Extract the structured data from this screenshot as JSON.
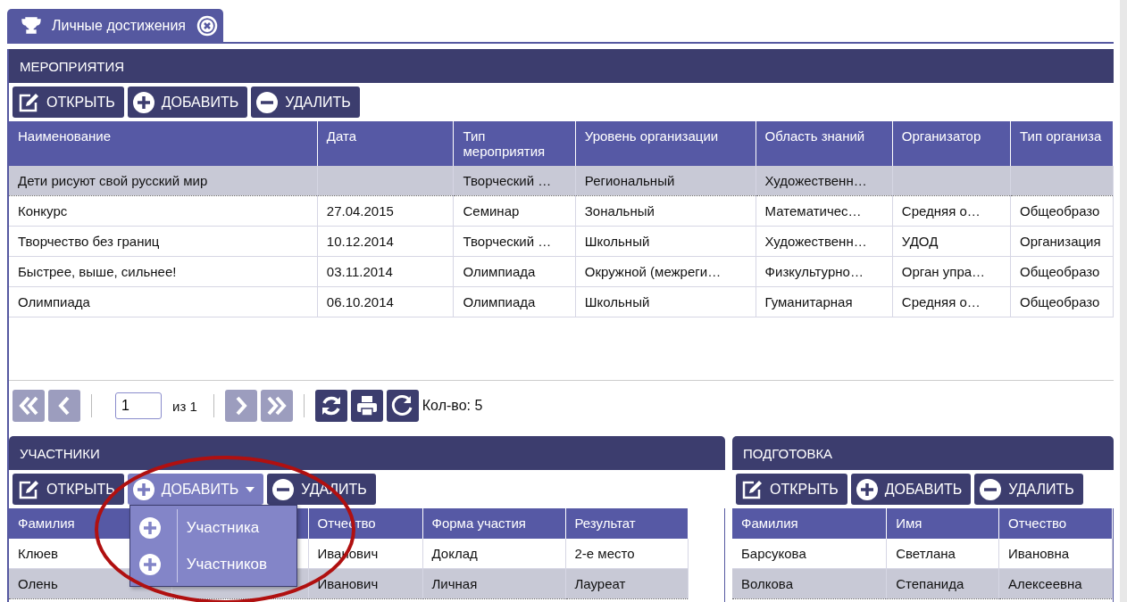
{
  "tab": {
    "label": "Личные достижения",
    "selected": true
  },
  "events": {
    "title": "МЕРОПРИЯТИЯ",
    "buttons": [
      {
        "kind": "open",
        "label": "ОТКРЫТЬ"
      },
      {
        "kind": "add",
        "label": "ДОБАВИТЬ"
      },
      {
        "kind": "delete",
        "label": "УДАЛИТЬ"
      }
    ],
    "columns": [
      "Наименование",
      "Дата",
      "Тип мероприятия",
      "Уровень организации",
      "Область знаний",
      "Организатор",
      "Тип организа"
    ],
    "rows": [
      {
        "selected": true,
        "cells": [
          "Дети рисуют свой русский мир",
          "",
          "Творческий …",
          "Региональный",
          "Художественн…",
          "",
          ""
        ]
      },
      {
        "selected": false,
        "cells": [
          "Конкурс",
          "27.04.2015",
          "Семинар",
          "Зональный",
          "Математичес…",
          "Средняя о…",
          "Общеобразо"
        ]
      },
      {
        "selected": false,
        "cells": [
          "Творчество без границ",
          "10.12.2014",
          "Творческий …",
          "Школьный",
          "Художественн…",
          "УДОД",
          "Организация"
        ]
      },
      {
        "selected": false,
        "cells": [
          "Быстрее, выше, сильнее!",
          "03.11.2014",
          "Олимпиада",
          "Окружной (межреги…",
          "Физкультурно…",
          "Орган упра…",
          "Общеобразо"
        ]
      },
      {
        "selected": false,
        "cells": [
          "Олимпиада",
          "06.10.2014",
          "Олимпиада",
          "Школьный",
          "Гуманитарная",
          "Средняя о…",
          "Общеобразо"
        ]
      }
    ],
    "pager": {
      "page": "1",
      "of": "из 1",
      "count": "Кол-во: 5",
      "first_disabled": true,
      "prev_disabled": true,
      "next_disabled": true,
      "last_disabled": true
    }
  },
  "participants": {
    "title": "УЧАСТНИКИ",
    "buttons": [
      {
        "kind": "open",
        "label": "ОТКРЫТЬ"
      },
      {
        "kind": "add",
        "label": "ДОБАВИТЬ",
        "expanded": true
      },
      {
        "kind": "delete",
        "label": "УДАЛИТЬ"
      }
    ],
    "menu": [
      "Участника",
      "Участников"
    ],
    "columns": [
      "Фамилия",
      "",
      "Отчество",
      "Форма участия",
      "Результат"
    ],
    "rows": [
      {
        "selected": false,
        "cells": [
          "Клюев",
          "",
          "Иванович",
          "Доклад",
          "2-е место"
        ]
      },
      {
        "selected": true,
        "cells": [
          "Олень",
          "",
          "Иванович",
          "Личная",
          "Лауреат"
        ]
      }
    ]
  },
  "preparation": {
    "title": "ПОДГОТОВКА",
    "buttons": [
      {
        "kind": "open",
        "label": "ОТКРЫТЬ"
      },
      {
        "kind": "add",
        "label": "ДОБАВИТЬ"
      },
      {
        "kind": "delete",
        "label": "УДАЛИТЬ"
      }
    ],
    "columns": [
      "Фамилия",
      "Имя",
      "Отчество"
    ],
    "rows": [
      {
        "selected": false,
        "cells": [
          "Барсукова",
          "Светлана",
          "Ивановна"
        ]
      },
      {
        "selected": true,
        "cells": [
          "Волкова",
          "Степанида",
          "Алексеевна"
        ]
      }
    ]
  }
}
